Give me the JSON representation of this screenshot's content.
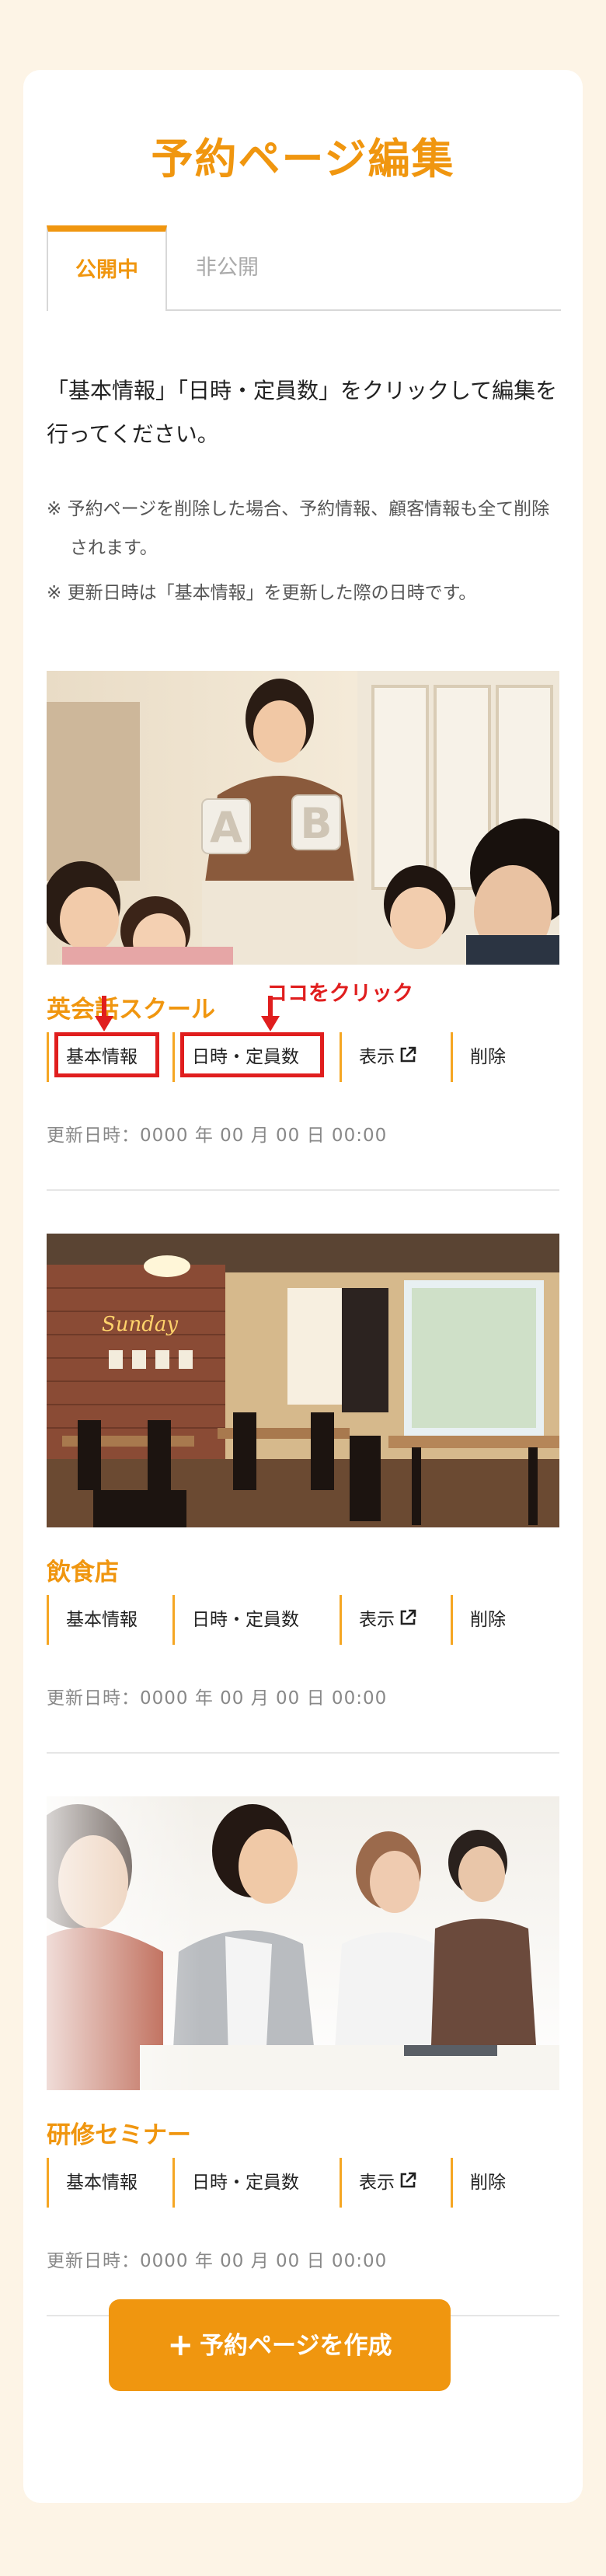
{
  "page": {
    "title": "予約ページ編集",
    "tabs": [
      {
        "label": "公開中",
        "active": true
      },
      {
        "label": "非公開",
        "active": false
      }
    ],
    "intro": "「基本情報」「日時・定員数」をクリックして編集を行ってください。",
    "notes": [
      "※ 予約ページを削除した場合、予約情報、顧客情報も全て削除されます。",
      "※ 更新日時は「基本情報」を更新した際の日時です。"
    ]
  },
  "items": [
    {
      "name": "英会話スクール",
      "image": "english-school-photo",
      "actions": {
        "basic": "基本情報",
        "datetime": "日時・定員数",
        "view": "表示",
        "delete": "削除"
      },
      "updated": "更新日時：0000 年 00 月 00 日 00:00"
    },
    {
      "name": "飲食店",
      "image": "restaurant-photo",
      "actions": {
        "basic": "基本情報",
        "datetime": "日時・定員数",
        "view": "表示",
        "delete": "削除"
      },
      "updated": "更新日時：0000 年 00 月 00 日 00:00"
    },
    {
      "name": "研修セミナー",
      "image": "seminar-photo",
      "actions": {
        "basic": "基本情報",
        "datetime": "日時・定員数",
        "view": "表示",
        "delete": "削除"
      },
      "updated": "更新日時：0000 年 00 月 00 日 00:00"
    }
  ],
  "annotation": {
    "text": "ココをクリック",
    "color": "#e01e1e"
  },
  "create_button": {
    "icon": "plus-icon",
    "label": "予約ページを作成"
  },
  "colors": {
    "accent": "#f0960f",
    "background": "#fdf4e6",
    "annotation": "#e01e1e"
  }
}
